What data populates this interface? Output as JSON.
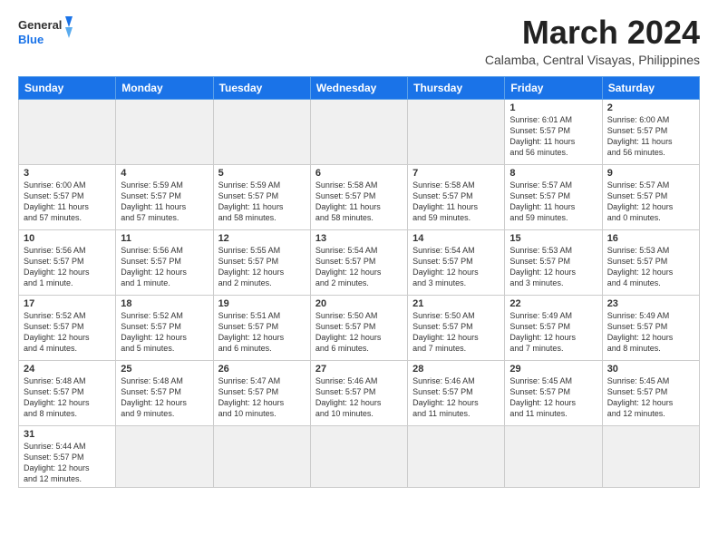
{
  "logo": {
    "line1": "General",
    "line2": "Blue"
  },
  "title": "March 2024",
  "subtitle": "Calamba, Central Visayas, Philippines",
  "days_of_week": [
    "Sunday",
    "Monday",
    "Tuesday",
    "Wednesday",
    "Thursday",
    "Friday",
    "Saturday"
  ],
  "weeks": [
    [
      {
        "day": "",
        "info": ""
      },
      {
        "day": "",
        "info": ""
      },
      {
        "day": "",
        "info": ""
      },
      {
        "day": "",
        "info": ""
      },
      {
        "day": "",
        "info": ""
      },
      {
        "day": "1",
        "info": "Sunrise: 6:01 AM\nSunset: 5:57 PM\nDaylight: 11 hours\nand 56 minutes."
      },
      {
        "day": "2",
        "info": "Sunrise: 6:00 AM\nSunset: 5:57 PM\nDaylight: 11 hours\nand 56 minutes."
      }
    ],
    [
      {
        "day": "3",
        "info": "Sunrise: 6:00 AM\nSunset: 5:57 PM\nDaylight: 11 hours\nand 57 minutes."
      },
      {
        "day": "4",
        "info": "Sunrise: 5:59 AM\nSunset: 5:57 PM\nDaylight: 11 hours\nand 57 minutes."
      },
      {
        "day": "5",
        "info": "Sunrise: 5:59 AM\nSunset: 5:57 PM\nDaylight: 11 hours\nand 58 minutes."
      },
      {
        "day": "6",
        "info": "Sunrise: 5:58 AM\nSunset: 5:57 PM\nDaylight: 11 hours\nand 58 minutes."
      },
      {
        "day": "7",
        "info": "Sunrise: 5:58 AM\nSunset: 5:57 PM\nDaylight: 11 hours\nand 59 minutes."
      },
      {
        "day": "8",
        "info": "Sunrise: 5:57 AM\nSunset: 5:57 PM\nDaylight: 11 hours\nand 59 minutes."
      },
      {
        "day": "9",
        "info": "Sunrise: 5:57 AM\nSunset: 5:57 PM\nDaylight: 12 hours\nand 0 minutes."
      }
    ],
    [
      {
        "day": "10",
        "info": "Sunrise: 5:56 AM\nSunset: 5:57 PM\nDaylight: 12 hours\nand 1 minute."
      },
      {
        "day": "11",
        "info": "Sunrise: 5:56 AM\nSunset: 5:57 PM\nDaylight: 12 hours\nand 1 minute."
      },
      {
        "day": "12",
        "info": "Sunrise: 5:55 AM\nSunset: 5:57 PM\nDaylight: 12 hours\nand 2 minutes."
      },
      {
        "day": "13",
        "info": "Sunrise: 5:54 AM\nSunset: 5:57 PM\nDaylight: 12 hours\nand 2 minutes."
      },
      {
        "day": "14",
        "info": "Sunrise: 5:54 AM\nSunset: 5:57 PM\nDaylight: 12 hours\nand 3 minutes."
      },
      {
        "day": "15",
        "info": "Sunrise: 5:53 AM\nSunset: 5:57 PM\nDaylight: 12 hours\nand 3 minutes."
      },
      {
        "day": "16",
        "info": "Sunrise: 5:53 AM\nSunset: 5:57 PM\nDaylight: 12 hours\nand 4 minutes."
      }
    ],
    [
      {
        "day": "17",
        "info": "Sunrise: 5:52 AM\nSunset: 5:57 PM\nDaylight: 12 hours\nand 4 minutes."
      },
      {
        "day": "18",
        "info": "Sunrise: 5:52 AM\nSunset: 5:57 PM\nDaylight: 12 hours\nand 5 minutes."
      },
      {
        "day": "19",
        "info": "Sunrise: 5:51 AM\nSunset: 5:57 PM\nDaylight: 12 hours\nand 6 minutes."
      },
      {
        "day": "20",
        "info": "Sunrise: 5:50 AM\nSunset: 5:57 PM\nDaylight: 12 hours\nand 6 minutes."
      },
      {
        "day": "21",
        "info": "Sunrise: 5:50 AM\nSunset: 5:57 PM\nDaylight: 12 hours\nand 7 minutes."
      },
      {
        "day": "22",
        "info": "Sunrise: 5:49 AM\nSunset: 5:57 PM\nDaylight: 12 hours\nand 7 minutes."
      },
      {
        "day": "23",
        "info": "Sunrise: 5:49 AM\nSunset: 5:57 PM\nDaylight: 12 hours\nand 8 minutes."
      }
    ],
    [
      {
        "day": "24",
        "info": "Sunrise: 5:48 AM\nSunset: 5:57 PM\nDaylight: 12 hours\nand 8 minutes."
      },
      {
        "day": "25",
        "info": "Sunrise: 5:48 AM\nSunset: 5:57 PM\nDaylight: 12 hours\nand 9 minutes."
      },
      {
        "day": "26",
        "info": "Sunrise: 5:47 AM\nSunset: 5:57 PM\nDaylight: 12 hours\nand 10 minutes."
      },
      {
        "day": "27",
        "info": "Sunrise: 5:46 AM\nSunset: 5:57 PM\nDaylight: 12 hours\nand 10 minutes."
      },
      {
        "day": "28",
        "info": "Sunrise: 5:46 AM\nSunset: 5:57 PM\nDaylight: 12 hours\nand 11 minutes."
      },
      {
        "day": "29",
        "info": "Sunrise: 5:45 AM\nSunset: 5:57 PM\nDaylight: 12 hours\nand 11 minutes."
      },
      {
        "day": "30",
        "info": "Sunrise: 5:45 AM\nSunset: 5:57 PM\nDaylight: 12 hours\nand 12 minutes."
      }
    ],
    [
      {
        "day": "31",
        "info": "Sunrise: 5:44 AM\nSunset: 5:57 PM\nDaylight: 12 hours\nand 12 minutes."
      },
      {
        "day": "",
        "info": ""
      },
      {
        "day": "",
        "info": ""
      },
      {
        "day": "",
        "info": ""
      },
      {
        "day": "",
        "info": ""
      },
      {
        "day": "",
        "info": ""
      },
      {
        "day": "",
        "info": ""
      }
    ]
  ]
}
